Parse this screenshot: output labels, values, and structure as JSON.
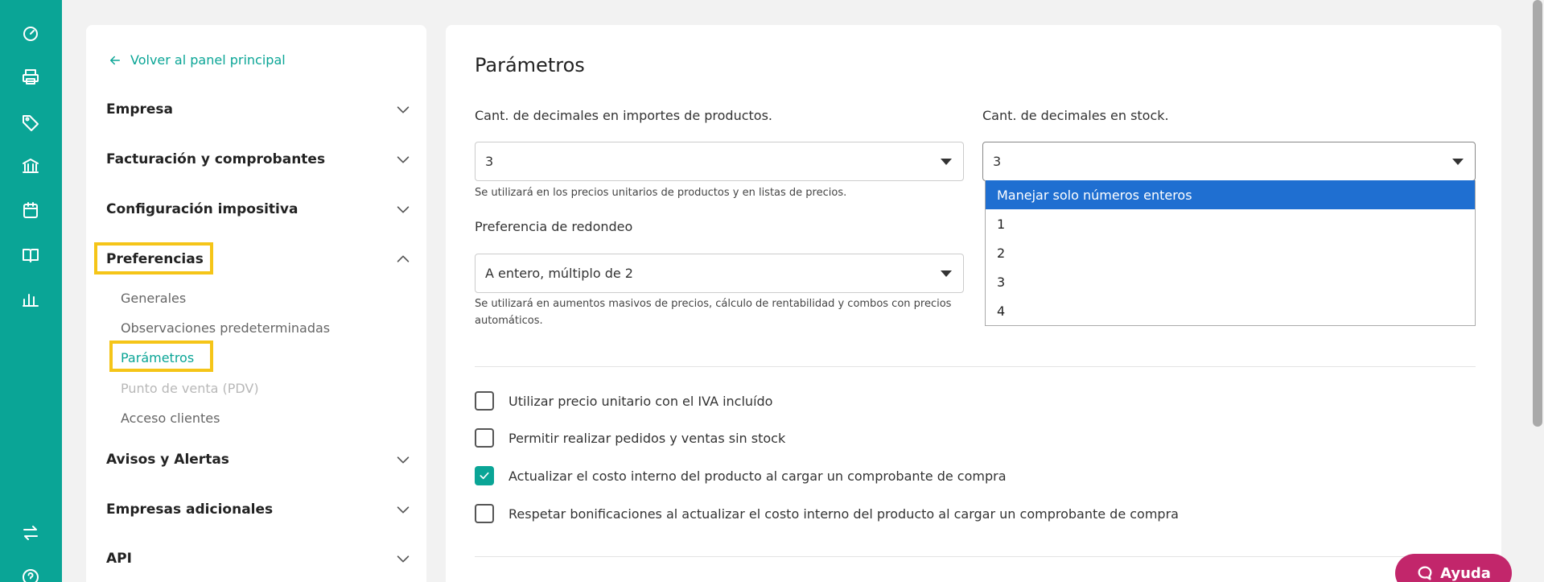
{
  "rail": {
    "icons": [
      "dashboard-icon",
      "printer-icon",
      "tag-icon",
      "bank-icon",
      "calendar-icon",
      "book-icon",
      "bar-chart-icon",
      "swap-icon",
      "help-circle-icon"
    ]
  },
  "nav": {
    "back_label": "Volver al panel principal",
    "sections": [
      {
        "label": "Empresa",
        "expanded": false
      },
      {
        "label": "Facturación y comprobantes",
        "expanded": false
      },
      {
        "label": "Configuración impositiva",
        "expanded": false
      },
      {
        "label": "Preferencias",
        "expanded": true
      },
      {
        "label": "Avisos y Alertas",
        "expanded": false
      },
      {
        "label": "Empresas adicionales",
        "expanded": false
      },
      {
        "label": "API",
        "expanded": false
      }
    ],
    "preferencias_items": [
      {
        "label": "Generales",
        "state": "normal"
      },
      {
        "label": "Observaciones predeterminadas",
        "state": "normal"
      },
      {
        "label": "Parámetros",
        "state": "active"
      },
      {
        "label": "Punto de venta (PDV)",
        "state": "disabled"
      },
      {
        "label": "Acceso clientes",
        "state": "normal"
      }
    ]
  },
  "main": {
    "title": "Parámetros",
    "decimales_importes": {
      "label": "Cant. de decimales en importes de productos.",
      "value": "3",
      "help": "Se utilizará en los precios unitarios de productos y en listas de precios."
    },
    "decimales_stock": {
      "label": "Cant. de decimales en stock.",
      "value": "3",
      "options": [
        "Manejar solo números enteros",
        "1",
        "2",
        "3",
        "4"
      ],
      "selected_option": "Manejar solo números enteros"
    },
    "redondeo": {
      "label": "Preferencia de redondeo",
      "value": "A entero, múltiplo de 2",
      "help_line1": "Se utilizará en aumentos masivos de precios, cálculo de rentabilidad y combos con precios",
      "help_line2": "automáticos."
    },
    "checkboxes": [
      {
        "label": "Utilizar precio unitario con el IVA incluído",
        "checked": false
      },
      {
        "label": "Permitir realizar pedidos y ventas sin stock",
        "checked": false
      },
      {
        "label": "Actualizar el costo interno del producto al cargar un comprobante de compra",
        "checked": true
      },
      {
        "label": "Respetar bonificaciones al actualizar el costo interno del producto al cargar un comprobante de compra",
        "checked": false
      }
    ]
  },
  "help_button": {
    "label": "Ayuda"
  },
  "colors": {
    "brand": "#0aa596",
    "highlight": "#f5c518",
    "selected_option": "#1f6fd1",
    "help_button": "#c2266b"
  }
}
